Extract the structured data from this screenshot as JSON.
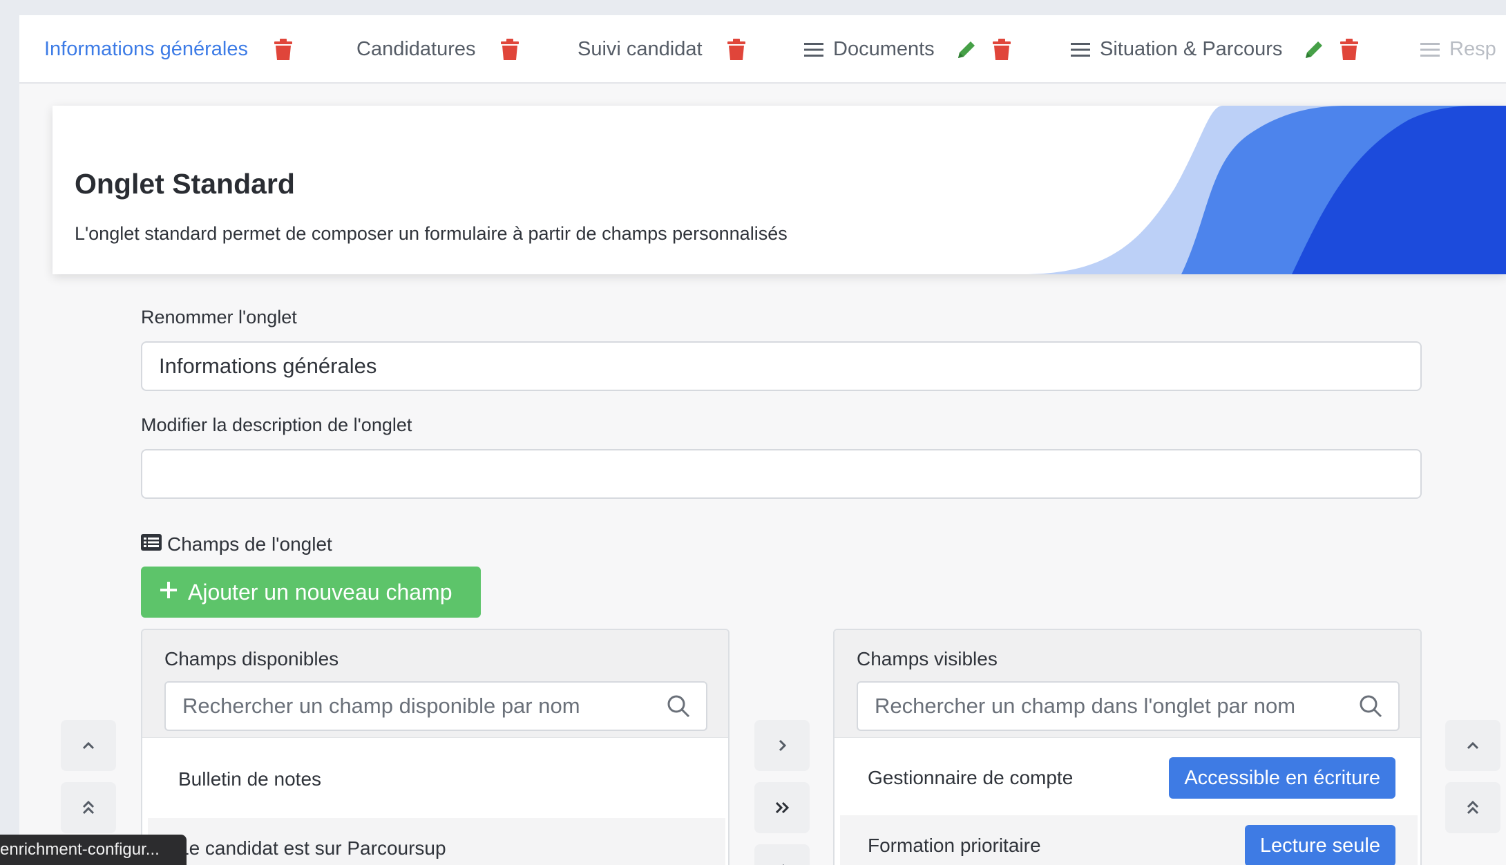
{
  "tabs": [
    {
      "label": "Informations générales",
      "active": true
    },
    {
      "label": "Candidatures"
    },
    {
      "label": "Suivi candidat"
    },
    {
      "label": "Documents"
    },
    {
      "label": "Situation & Parcours"
    },
    {
      "label": "Resp"
    }
  ],
  "hero": {
    "title": "Onglet Standard",
    "description": "L'onglet standard permet de composer un formulaire à partir de champs personnalisés"
  },
  "form": {
    "rename_label": "Renommer l'onglet",
    "rename_value": "Informations générales",
    "description_label": "Modifier la description de l'onglet",
    "description_value": "",
    "fields_title": "Champs de l'onglet",
    "add_button": "Ajouter un nouveau champ"
  },
  "available": {
    "title": "Champs disponibles",
    "search_placeholder": "Rechercher un champ disponible par nom",
    "items": [
      "Bulletin de notes",
      "Le candidat est sur Parcoursup"
    ]
  },
  "visible": {
    "title": "Champs visibles",
    "search_placeholder": "Rechercher un champ dans l'onglet par nom",
    "items": [
      {
        "label": "Gestionnaire de compte",
        "access": "Accessible en écriture"
      },
      {
        "label": "Formation prioritaire",
        "access": "Lecture seule"
      }
    ]
  },
  "tooltip": "enrichment-configur...",
  "colors": {
    "accent": "#3c7be6",
    "danger": "#e0453a",
    "success": "#5dc46a",
    "edit": "#46a047"
  }
}
